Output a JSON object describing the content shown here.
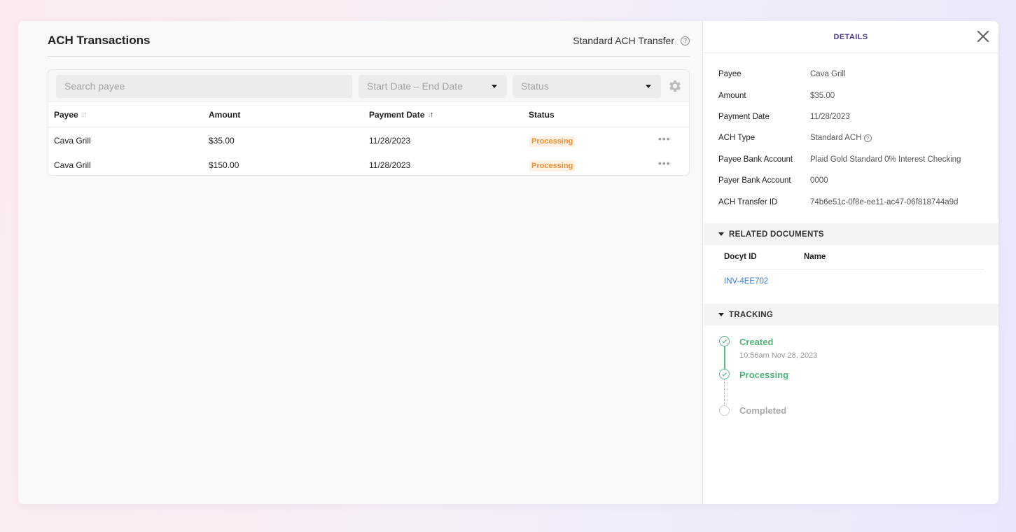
{
  "page": {
    "title": "ACH Transactions",
    "transfer_type": "Standard ACH Transfer"
  },
  "filters": {
    "search_placeholder": "Search payee",
    "date_placeholder": "Start Date – End Date",
    "status_placeholder": "Status"
  },
  "table": {
    "columns": [
      "Payee",
      "Amount",
      "Payment Date",
      "Status"
    ],
    "rows": [
      {
        "payee": "Cava Grill",
        "amount": "$35.00",
        "date": "11/28/2023",
        "status": "Processing"
      },
      {
        "payee": "Cava Grill",
        "amount": "$150.00",
        "date": "11/28/2023",
        "status": "Processing"
      }
    ]
  },
  "details": {
    "title": "DETAILS",
    "fields": [
      {
        "key": "Payee",
        "value": "Cava Grill"
      },
      {
        "key": "Amount",
        "value": "$35.00"
      },
      {
        "key": "Payment Date",
        "value": "11/28/2023"
      },
      {
        "key": "ACH Type",
        "value": "Standard ACH"
      },
      {
        "key": "Payee Bank Account",
        "value": "Plaid Gold Standard 0% Interest Checking"
      },
      {
        "key": "Payer Bank Account",
        "value": "0000"
      },
      {
        "key": "ACH Transfer ID",
        "value": "74b6e51c-0f8e-ee11-ac47-06f818744a9d"
      }
    ],
    "related_documents": {
      "title": "RELATED DOCUMENTS",
      "columns": [
        "Docyt ID",
        "Name"
      ],
      "rows": [
        {
          "docyt_id": "INV-4EE702",
          "name": ""
        }
      ]
    },
    "tracking": {
      "title": "TRACKING",
      "steps": [
        {
          "label": "Created",
          "time": "10:56am Nov 28, 2023",
          "state": "done"
        },
        {
          "label": "Processing",
          "time": "",
          "state": "done"
        },
        {
          "label": "Completed",
          "time": "",
          "state": "pending"
        }
      ]
    }
  },
  "colors": {
    "accent": "#4b3a8f",
    "success": "#4fb47a",
    "warning": "#f0913a",
    "link": "#3c7ad0"
  },
  "icons": [
    "help-icon",
    "gear-icon",
    "close-icon",
    "sort-icon",
    "more-icon",
    "check-icon",
    "caret-down-icon"
  ]
}
